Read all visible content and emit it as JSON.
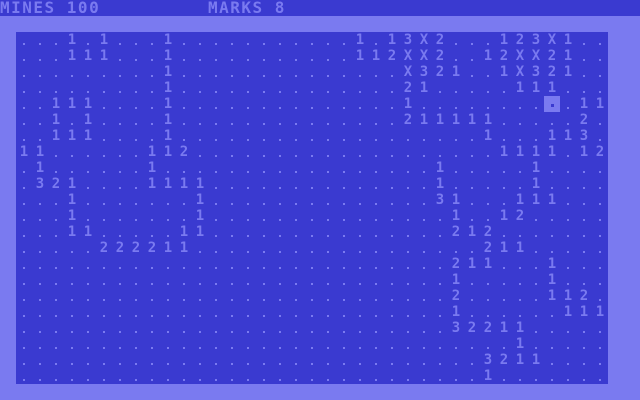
{
  "status": {
    "mines_text": "MINES 100",
    "marks_text": "MARKS 8"
  },
  "board": {
    "cursor": [
      34,
      4
    ],
    "rows": [
      "....1.1...1...........1.13X2...123X1....",
      "....111...1...........112XX2..12XX21....",
      "..........1..............X321..1X321....",
      "..........1..............21.....111.....",
      "...111....1..............1..........11..",
      "...1.1....1..............211111.....2...",
      "...111....1...................1...113...",
      "111......112...................1111.12..",
      "..1......1.................1.....1......",
      "..321....1111..............1.....1......",
      "....1.......1..............31...111.....",
      "....1.......1...............1..12.......",
      "....11.....11...............212.........",
      "......222211..................211.......",
      "............................211...1.....",
      "............................1.....1.....",
      "............................2.....112...",
      "............................1......111..",
      "............................32211.....1.",
      "................................1.....1.",
      "..............................3211....11",
      "1.............................1........."
    ]
  }
}
